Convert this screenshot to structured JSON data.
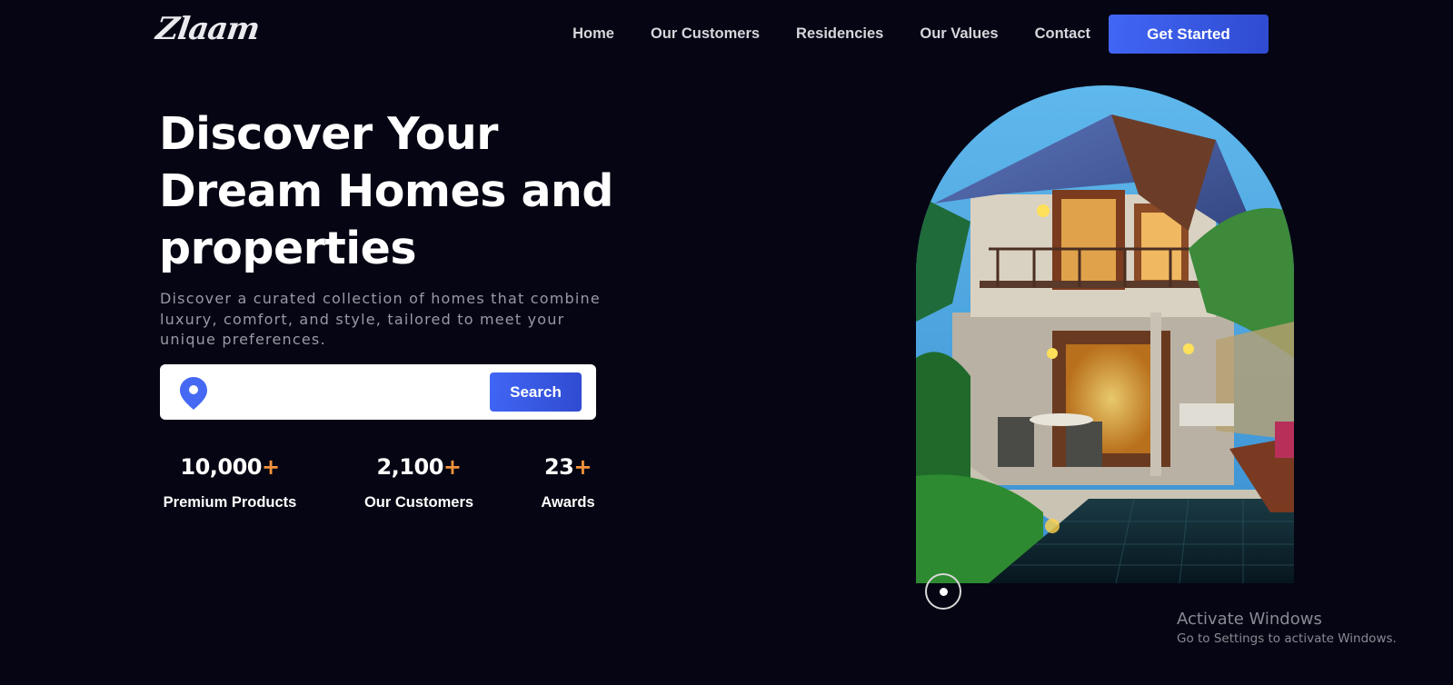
{
  "header": {
    "logo": "Zlaam",
    "nav": [
      "Home",
      "Our Customers",
      "Residencies",
      "Our Values",
      "Contact"
    ],
    "cta_label": "Get Started"
  },
  "hero": {
    "title_lines": [
      "Discover Your",
      "Dream Homes and",
      "properties"
    ],
    "description": "Discover a curated collection of homes that combine luxury, comfort, and style, tailored to meet your unique preferences.",
    "search": {
      "value": "",
      "button_label": "Search",
      "icon": "map-pin-icon"
    },
    "stats": [
      {
        "value": "10,000",
        "suffix": "+",
        "label": "Premium Products"
      },
      {
        "value": "2,100",
        "suffix": "+",
        "label": "Our Customers"
      },
      {
        "value": "23",
        "suffix": "+",
        "label": "Awards"
      }
    ]
  },
  "colors": {
    "background": "#050513",
    "accent": "#3f63f0",
    "plus": "#f5923b"
  },
  "watermark": {
    "title": "Activate Windows",
    "subtitle": "Go to Settings to activate Windows."
  }
}
